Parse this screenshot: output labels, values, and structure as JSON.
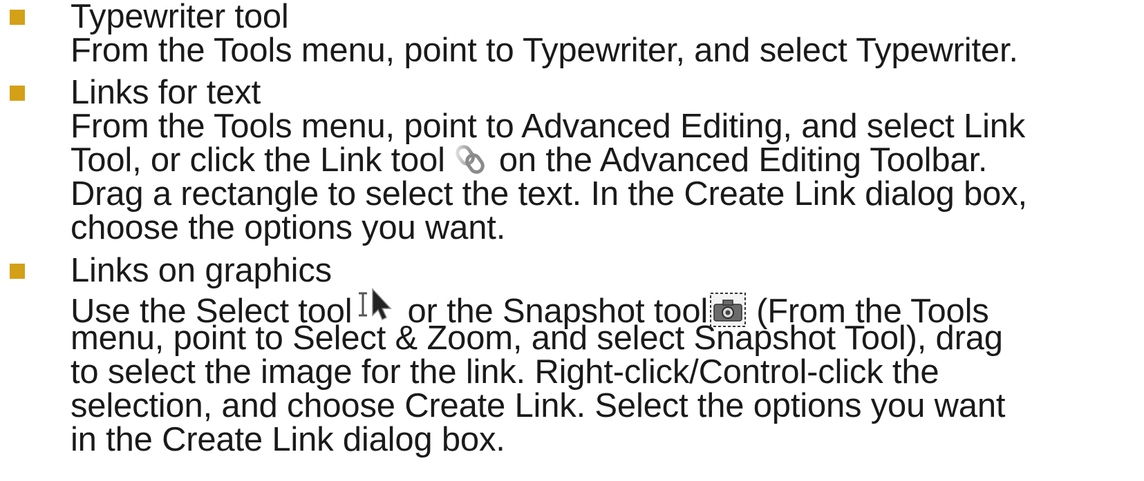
{
  "bullets": [
    {
      "title": "Typewriter tool",
      "lines": [
        "From the Tools menu, point to Typewriter, and select Typewriter."
      ]
    },
    {
      "title": "Links for text",
      "line1": "From the Tools menu, point to Advanced Editing, and select Link",
      "line2_before_icon": "Tool, or click the Link tool",
      "line2_after_icon": "on the Advanced Editing Toolbar.",
      "line3": "Drag a rectangle to select the text. In the Create Link dialog box,",
      "line4": "choose the options you want.",
      "icon": "chain-link-icon"
    },
    {
      "title": "Links on graphics",
      "line1_before_select": "Use the Select tool",
      "line1_between": "or the Snapshot tool",
      "line1_after_snapshot": "(From the Tools",
      "line2": "menu, point to Select & Zoom, and select Snapshot Tool), drag",
      "line3": "to select the image for the link. Right-click/Control-click the",
      "line4": "selection, and choose Create Link. Select the options you want",
      "line5": "in the Create Link dialog box.",
      "icons": [
        "select-tool-icon",
        "snapshot-camera-icon"
      ]
    }
  ],
  "colors": {
    "bullet": "#d4a017",
    "text": "#1a1a1a",
    "background": "#ffffff"
  }
}
